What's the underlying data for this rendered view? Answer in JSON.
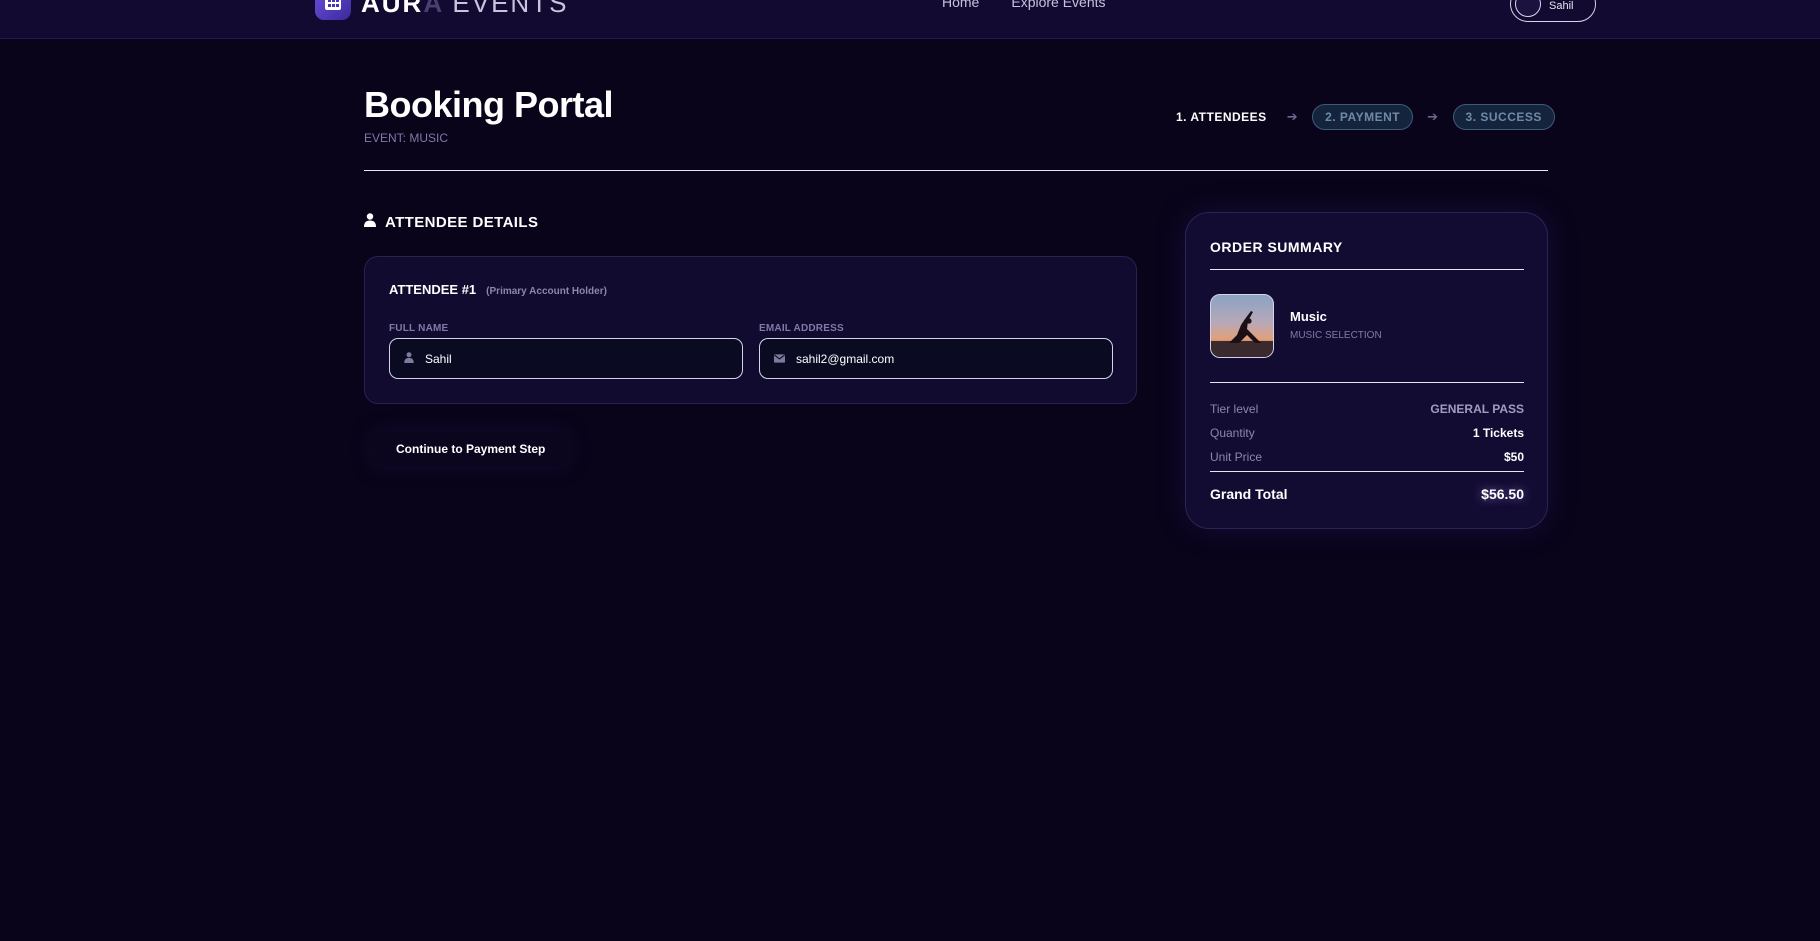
{
  "nav": {
    "logo_aura_main": "AUR",
    "logo_aura_fade": "A",
    "logo_events": "EVENTS",
    "links": [
      "Home",
      "Explore Events"
    ],
    "user_name": "Sahil"
  },
  "header": {
    "title": "Booking Portal",
    "event_label": "EVENT: MUSIC"
  },
  "stepper": {
    "steps": [
      "1. ATTENDEES",
      "2. PAYMENT",
      "3. SUCCESS"
    ],
    "arrow": "➔"
  },
  "attendee_section": {
    "heading": "ATTENDEE DETAILS",
    "card_title": "ATTENDEE #1",
    "card_subtitle": "(Primary Account Holder)",
    "full_name_label": "FULL NAME",
    "full_name_value": "Sahil",
    "email_label": "EMAIL ADDRESS",
    "email_value": "sahil2@gmail.com",
    "continue_label": "Continue to Payment Step"
  },
  "summary": {
    "title": "ORDER SUMMARY",
    "event_name": "Music",
    "event_sub": "MUSIC SELECTION",
    "rows": [
      {
        "label": "Tier level",
        "value": "GENERAL PASS"
      },
      {
        "label": "Quantity",
        "value": "1 Tickets"
      },
      {
        "label": "Unit Price",
        "value": "$50"
      }
    ],
    "total_label": "Grand Total",
    "total_value": "$56.50"
  },
  "colors": {
    "background": "#09041a",
    "navbar": "#120a30",
    "card": "#120b30",
    "pill_border": "#3f5a7a",
    "pill_text": "#6f8aa8"
  }
}
